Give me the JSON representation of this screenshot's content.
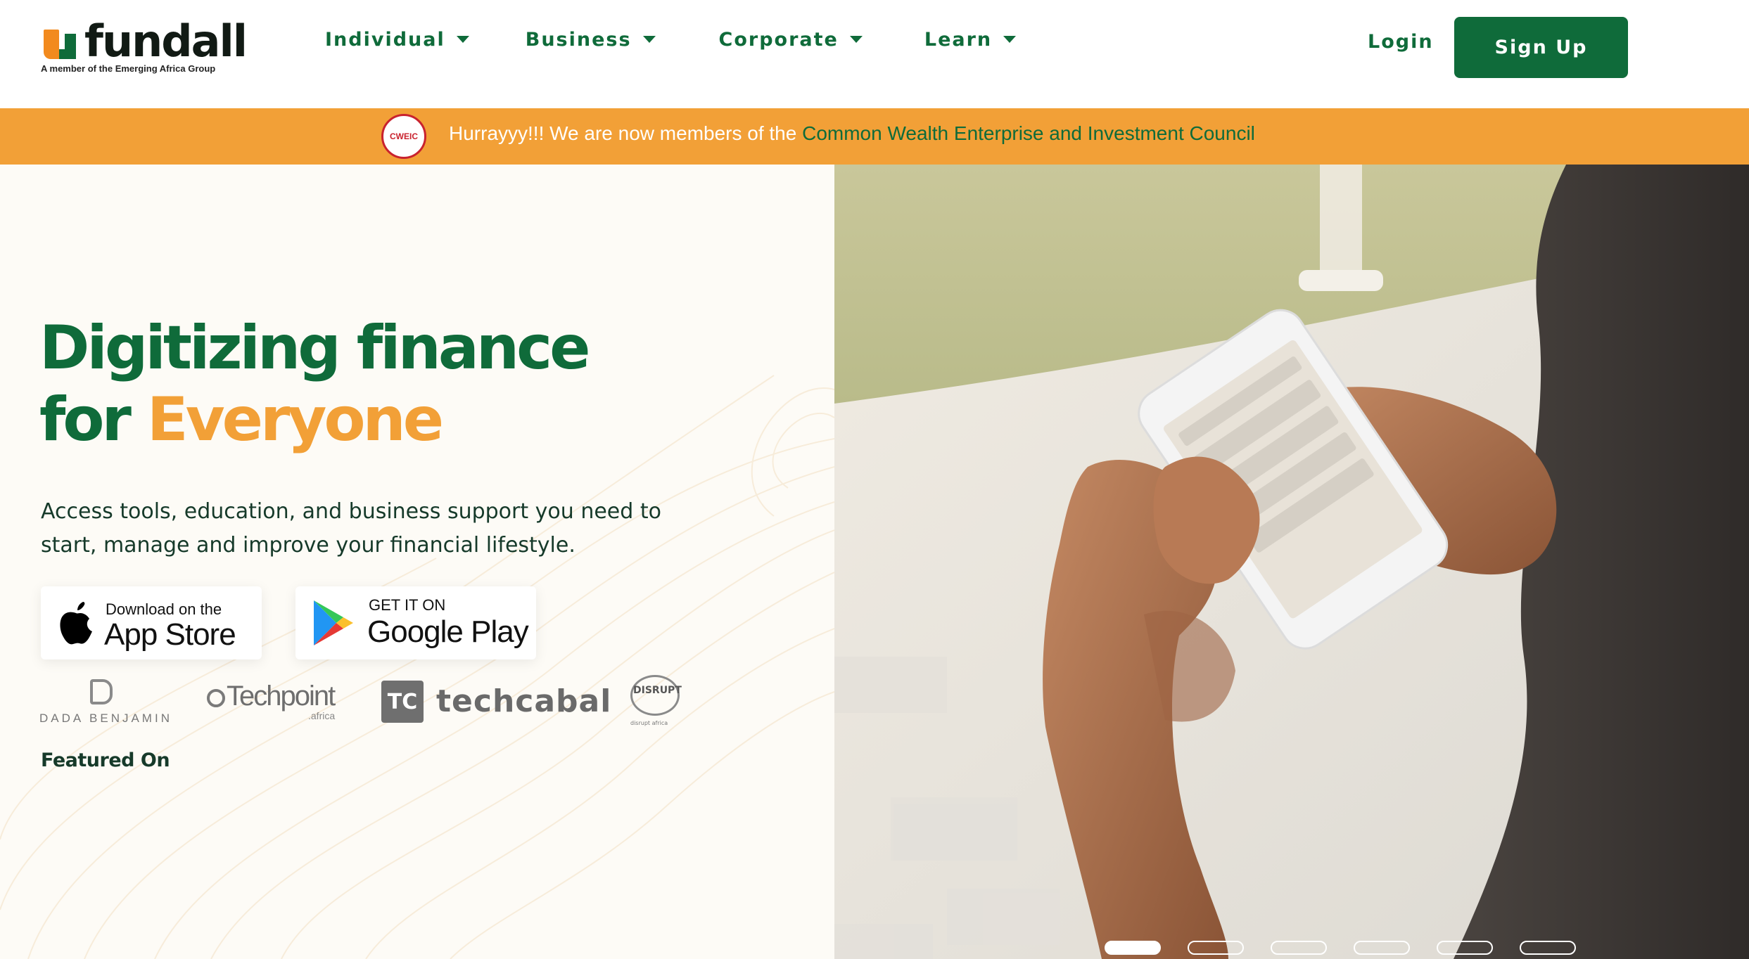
{
  "brand": {
    "name": "fundall",
    "tagline": "A member of the Emerging Africa Group"
  },
  "nav": {
    "items": [
      {
        "label": "Individual"
      },
      {
        "label": "Business"
      },
      {
        "label": "Corporate"
      },
      {
        "label": "Learn"
      }
    ],
    "login_label": "Login",
    "signup_label": "Sign Up"
  },
  "banner": {
    "badge": "CWEIC",
    "text": "Hurrayyy!!! We are now members of the ",
    "link": "Common Wealth Enterprise and Investment Council"
  },
  "hero": {
    "title_line1": "Digitizing finance",
    "title_for": "for ",
    "title_accent": "Everyone",
    "subtitle": "Access tools, education, and business support you need to start, manage and improve your financial lifestyle.",
    "app_store": {
      "small": "Download on the",
      "big": "App Store"
    },
    "google_play": {
      "small": "GET IT ON",
      "big": "Google Play"
    },
    "featured_label": "Featured On",
    "partners": {
      "dada": "DADA BENJAMIN",
      "techpoint": "Techpoint",
      "techpoint_sub": ".africa",
      "techcabal_mark": "TC",
      "techcabal": "techcabal",
      "disrupt": "DISRUPT",
      "disrupt_tag": "disrupt africa"
    }
  },
  "carousel": {
    "slide_count": 6,
    "active_index": 0
  },
  "colors": {
    "brand_green": "#0f6b3a",
    "accent_orange": "#f2a037",
    "hero_bg": "#fdfbf6"
  },
  "icons": [
    "caret-down-icon",
    "apple-icon",
    "google-play-icon",
    "cweic-badge"
  ]
}
